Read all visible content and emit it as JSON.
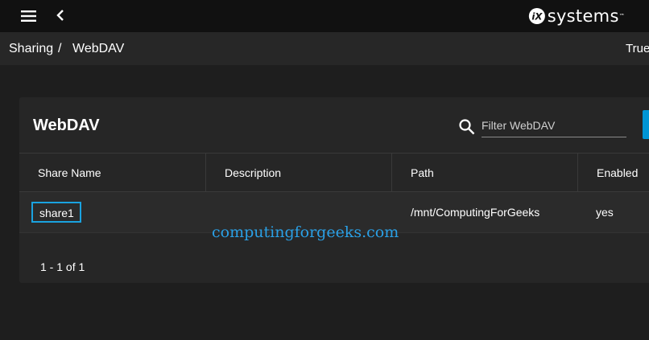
{
  "colors": {
    "accent": "#0095d5",
    "focus_outline": "#1aa3e0",
    "watermark": "#2aa0e6"
  },
  "topbar": {
    "menu_icon": "hamburger-menu-icon",
    "back_icon": "chevron-left-icon",
    "logo": {
      "mark": "iX",
      "text": "systems",
      "tm": "™"
    }
  },
  "breadcrumb": {
    "items": [
      "Sharing",
      "WebDAV"
    ],
    "separator": "/"
  },
  "header_right": {
    "text": "True"
  },
  "card": {
    "title": "WebDAV",
    "search": {
      "icon": "search-icon",
      "placeholder": "Filter WebDAV",
      "value": ""
    },
    "columns": [
      "Share Name",
      "Description",
      "Path",
      "Enabled"
    ],
    "rows": [
      {
        "share_name": "share1",
        "description": "",
        "path": "/mnt/ComputingForGeeks",
        "enabled": "yes"
      }
    ],
    "paginator": "1 - 1 of 1"
  },
  "watermark": "computingforgeeks.com"
}
